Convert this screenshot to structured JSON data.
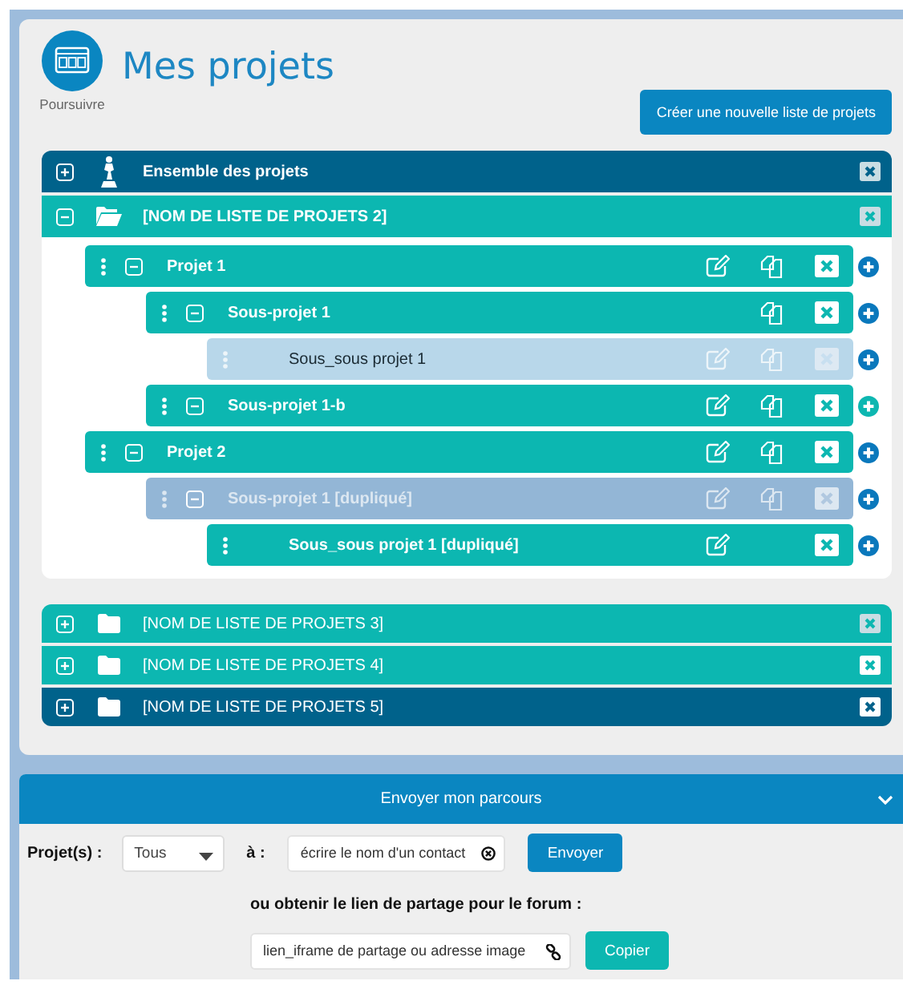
{
  "header": {
    "title": "Mes projets",
    "caption": "Poursuivre",
    "create_button": "Créer une nouvelle liste de projets"
  },
  "lists": [
    {
      "label": "Ensemble des projets",
      "kind": "all",
      "selected": true,
      "expanded": false,
      "delete_enabled": false
    },
    {
      "label": "[NOM DE LISTE DE PROJETS 2]",
      "kind": "list",
      "selected": false,
      "expanded": true,
      "delete_enabled": false,
      "projects": [
        {
          "label": "Projet 1",
          "kind": "active",
          "expanded": true,
          "edit": true,
          "copy": true,
          "color": "#0a78bc",
          "children": [
            {
              "label": "Sous-projet 1",
              "kind": "active",
              "expanded": true,
              "edit": false,
              "copy": true,
              "color": "#0a78bc",
              "children": [
                {
                  "label": "Sous_sous projet 1",
                  "kind": "inactive",
                  "edit": true,
                  "copy": true,
                  "color": "#0a78bc"
                }
              ]
            },
            {
              "label": "Sous-projet 1-b",
              "kind": "active",
              "expanded": true,
              "edit": true,
              "copy": true,
              "color": "#0db7b1"
            }
          ]
        },
        {
          "label": "Projet 2",
          "kind": "active",
          "expanded": true,
          "edit": true,
          "copy": true,
          "color": "#0a78bc",
          "children": [
            {
              "label": "Sous-projet 1 [dupliqué]",
              "kind": "duplicate",
              "expanded": true,
              "edit": true,
              "copy": true,
              "color": "#0a78bc",
              "children": [
                {
                  "label": "Sous_sous projet 1 [dupliqué]",
                  "kind": "active",
                  "edit": true,
                  "copy": false,
                  "color": "#0a78bc"
                }
              ]
            }
          ]
        }
      ]
    },
    {
      "label": "[NOM DE LISTE DE PROJETS 3]",
      "kind": "list",
      "selected": false,
      "expanded": false,
      "delete_enabled": false
    },
    {
      "label": "[NOM DE LISTE DE PROJETS 4]",
      "kind": "list",
      "selected": false,
      "expanded": false,
      "delete_enabled": true
    },
    {
      "label": "[NOM DE LISTE DE PROJETS 5]",
      "kind": "list",
      "selected": true,
      "expanded": false,
      "delete_enabled": true
    }
  ],
  "send": {
    "title": "Envoyer mon parcours",
    "projects_label": "Projet(s) :",
    "projects_value": "Tous",
    "to_label": "à :",
    "contact_placeholder": "écrire le nom d'un contact",
    "send_button": "Envoyer",
    "share_label": "ou obtenir le lien de partage pour le forum :",
    "link_placeholder": "lien_iframe de partage ou adresse image",
    "copy_button": "Copier"
  }
}
